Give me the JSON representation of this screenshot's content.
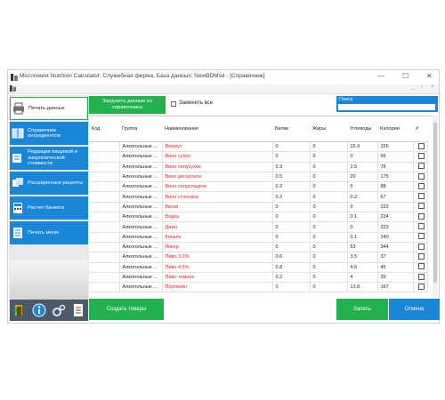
{
  "window": {
    "title": "Micronwest Nutrition Calculator: Служебная фирма, База данных: NewBDMsd - [Справочник]",
    "min": "—",
    "max": "☐",
    "close": "✕",
    "mdi_min": "_",
    "mdi_max": "▫",
    "mdi_close": "×"
  },
  "sidebar": {
    "items": [
      {
        "label": "Печать данных",
        "icon": "printer-icon"
      },
      {
        "label": "Справочник ингредиентов",
        "icon": "book-icon"
      },
      {
        "label": "Редакция пищевой и энергетической стоимости",
        "icon": "edit-icon"
      },
      {
        "label": "Расширенные рецепты",
        "icon": "recipes-icon"
      },
      {
        "label": "Расчет банкета",
        "icon": "calculator-icon"
      },
      {
        "label": "Печать меню",
        "icon": "menu-icon"
      }
    ],
    "bottom_icons": [
      "exit-icon",
      "info-icon",
      "settings-icon",
      "report-icon"
    ]
  },
  "toolbar": {
    "load_label": "Загрузить данные из справочника",
    "replace_all_label": "Заменить все",
    "search_label": "Поиск",
    "search_value": ""
  },
  "table": {
    "columns": [
      "Код",
      "Группа",
      "Наименование",
      "Белки",
      "Жиры",
      "Углеводы",
      "Калории",
      "#"
    ],
    "rows": [
      {
        "code": "",
        "group": "Алкогольные ...",
        "name": "Вермут",
        "protein": "0",
        "fat": "0",
        "carbs": "15.9",
        "kcal": "155"
      },
      {
        "code": "",
        "group": "Алкогольные ...",
        "name": "Вино сухое",
        "protein": "0",
        "fat": "0",
        "carbs": "0",
        "kcal": "66"
      },
      {
        "code": "",
        "group": "Алкогольные ...",
        "name": "Вино полусухое",
        "protein": "0.3",
        "fat": "0",
        "carbs": "2.5",
        "kcal": "78"
      },
      {
        "code": "",
        "group": "Алкогольные ...",
        "name": "Вино десертное",
        "protein": "0.5",
        "fat": "0",
        "carbs": "20",
        "kcal": "175"
      },
      {
        "code": "",
        "group": "Алкогольные ...",
        "name": "Вино полусладкое",
        "protein": "0.2",
        "fat": "0",
        "carbs": "5",
        "kcal": "88"
      },
      {
        "code": "",
        "group": "Алкогольные ...",
        "name": "Вино столовое",
        "protein": "0.2",
        "fat": "0",
        "carbs": "0.2",
        "kcal": "67"
      },
      {
        "code": "",
        "group": "Алкогольные ...",
        "name": "Виски",
        "protein": "0",
        "fat": "0",
        "carbs": "0",
        "kcal": "222"
      },
      {
        "code": "",
        "group": "Алкогольные ...",
        "name": "Водка",
        "protein": "0",
        "fat": "0",
        "carbs": "0.1",
        "kcal": "234"
      },
      {
        "code": "",
        "group": "Алкогольные ...",
        "name": "Джин",
        "protein": "0",
        "fat": "0",
        "carbs": "0",
        "kcal": "223"
      },
      {
        "code": "",
        "group": "Алкогольные ...",
        "name": "Коньяк",
        "protein": "0",
        "fat": "0",
        "carbs": "0.1",
        "kcal": "240"
      },
      {
        "code": "",
        "group": "Алкогольные ...",
        "name": "Ликер",
        "protein": "0",
        "fat": "0",
        "carbs": "53",
        "kcal": "344"
      },
      {
        "code": "",
        "group": "Алкогольные ...",
        "name": "Пиво 3.0%",
        "protein": "0.6",
        "fat": "0",
        "carbs": "3.5",
        "kcal": "37"
      },
      {
        "code": "",
        "group": "Алкогольные ...",
        "name": "Пиво 4.5%",
        "protein": "0.8",
        "fat": "0",
        "carbs": "4.5",
        "kcal": "45"
      },
      {
        "code": "",
        "group": "Алкогольные ...",
        "name": "Пиво темное",
        "protein": "0.2",
        "fat": "0",
        "carbs": "4",
        "kcal": "39"
      },
      {
        "code": "",
        "group": "Алкогольные ...",
        "name": "Портвейн",
        "protein": "0",
        "fat": "0",
        "carbs": "13.8",
        "kcal": "167"
      }
    ]
  },
  "buttons": {
    "create_label": "Создать товары",
    "save_label": "Запись",
    "cancel_label": "Отмена"
  },
  "colors": {
    "green": "#21b24b",
    "blue": "#1a86d8",
    "name_red": "#e02424"
  }
}
